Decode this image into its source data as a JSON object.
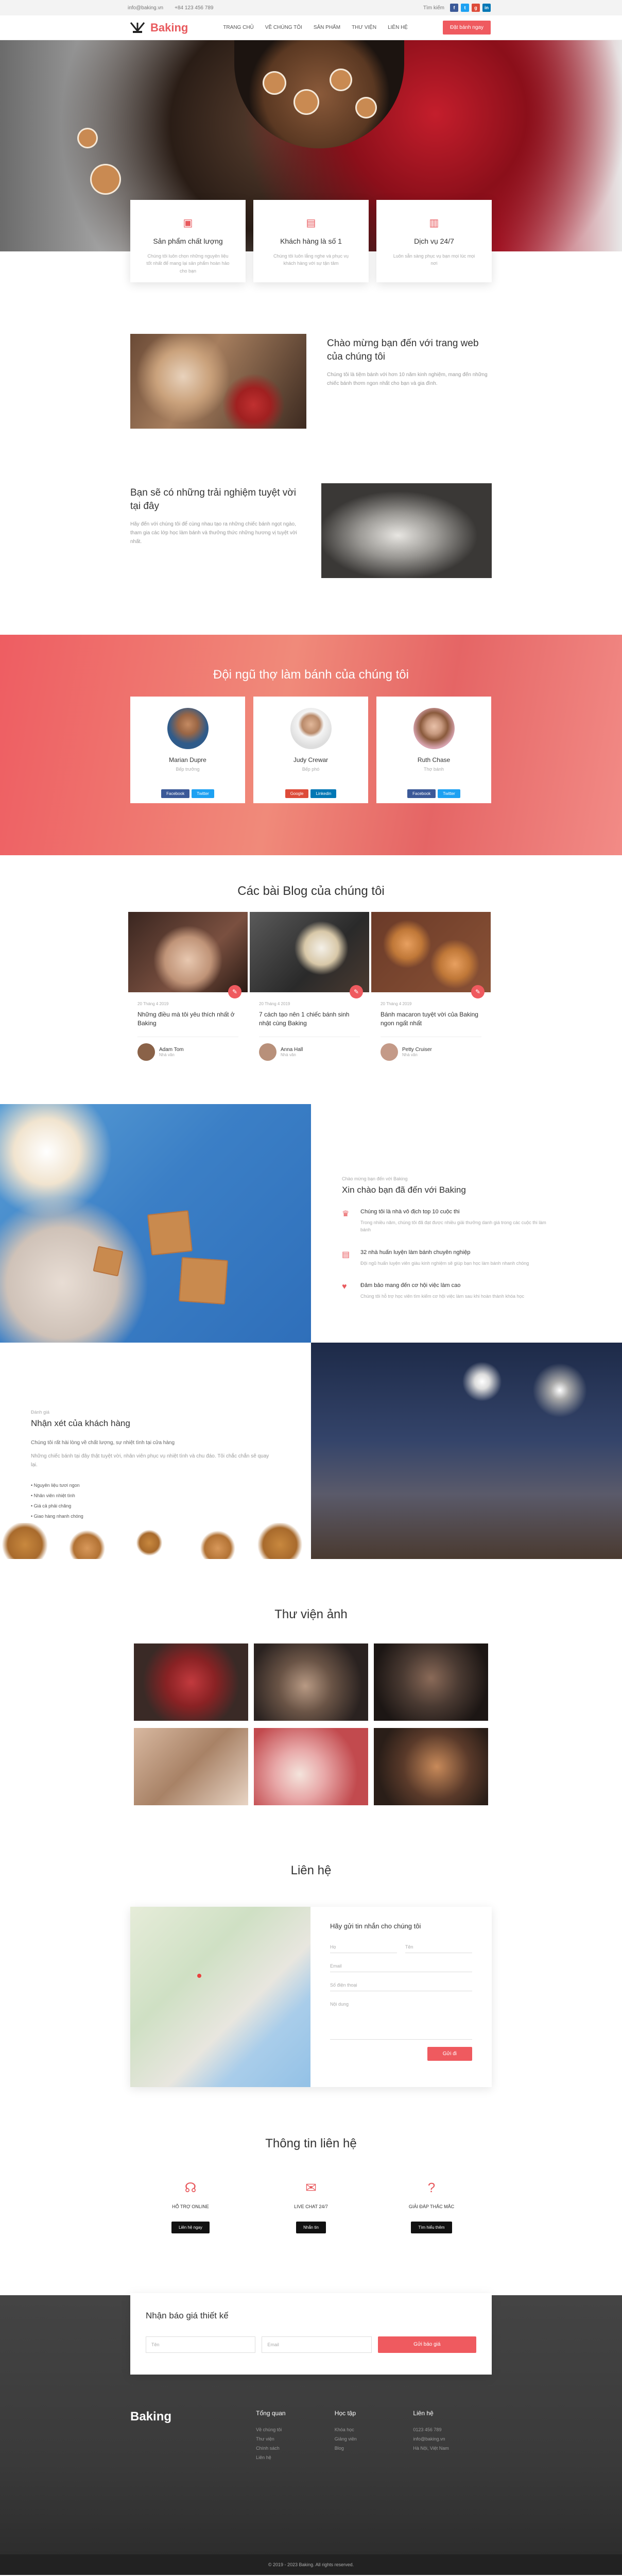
{
  "topbar": {
    "email": "info@baking.vn",
    "phone": "+84 123 456 789",
    "search": "Tìm kiếm",
    "social": [
      "f",
      "t",
      "g",
      "in"
    ]
  },
  "nav": {
    "logo": "Baking",
    "menu": [
      "Trang chủ",
      "Về chúng tôi",
      "Sản phẩm",
      "Thư viện",
      "Liên hệ"
    ],
    "cta": "Đặt bánh ngay"
  },
  "features": [
    {
      "icon": "gift-icon",
      "title": "Sản phẩm chất lượng",
      "text": "Chúng tôi luôn chọn những nguyên liệu tốt nhất để mang lại sản phẩm hoàn hảo cho bạn"
    },
    {
      "icon": "cart-icon",
      "title": "Khách hàng là số 1",
      "text": "Chúng tôi luôn lắng nghe và phục vụ khách hàng với sự tận tâm"
    },
    {
      "icon": "box-icon",
      "title": "Dịch vụ 24/7",
      "text": "Luôn sẵn sàng phục vụ bạn mọi lúc mọi nơi"
    }
  ],
  "about": {
    "title": "Chào mừng bạn đến với trang web của chúng tôi",
    "text": "Chúng tôi là tiệm bánh với hơn 10 năm kinh nghiệm, mang đến những chiếc bánh thơm ngon nhất cho bạn và gia đình."
  },
  "experience": {
    "title": "Bạn sẽ có những trải nghiệm tuyệt vời tại đây",
    "text": "Hãy đến với chúng tôi để cùng nhau tạo ra những chiếc bánh ngọt ngào, tham gia các lớp học làm bánh và thưởng thức những hương vị tuyệt vời nhất."
  },
  "team": {
    "title": "Đội ngũ thợ làm bánh của chúng tôi",
    "members": [
      {
        "name": "Marian Dupre",
        "role": "Bếp trưởng",
        "btn1": "Facebook",
        "btn2": "Twitter"
      },
      {
        "name": "Judy Crewar",
        "role": "Bếp phó",
        "btn1": "Google",
        "btn2": "Linkedin"
      },
      {
        "name": "Ruth Chase",
        "role": "Thợ bánh",
        "btn1": "Facebook",
        "btn2": "Twitter"
      }
    ]
  },
  "blog": {
    "title": "Các bài Blog của chúng tôi",
    "posts": [
      {
        "date": "20 Tháng 4 2019",
        "title": "Những điều mà tôi yêu thích nhất ở Baking",
        "author": "Adam Tom",
        "role": "Nhà văn"
      },
      {
        "date": "20 Tháng 4 2019",
        "title": "7 cách tạo nên 1 chiếc bánh sinh nhật cùng Baking",
        "author": "Anna Hall",
        "role": "Nhà văn"
      },
      {
        "date": "20 Tháng 4 2019",
        "title": "Bánh macaron tuyệt vời của Baking ngon ngất nhất",
        "author": "Petty Cruiser",
        "role": "Nhà văn"
      }
    ]
  },
  "welcome": {
    "kicker": "Chào mừng bạn đến với Baking",
    "title": "Xin chào bạn đã đến với Baking",
    "items": [
      {
        "icon": "trophy-icon",
        "title": "Chúng tôi là nhà vô địch top 10 cuộc thi",
        "text": "Trong nhiều năm, chúng tôi đã đạt được nhiều giải thưởng danh giá trong các cuộc thi làm bánh"
      },
      {
        "icon": "book-icon",
        "title": "32 nhà huấn luyện làm bánh chuyên nghiệp",
        "text": "Đội ngũ huấn luyện viên giàu kinh nghiệm sẽ giúp bạn học làm bánh nhanh chóng"
      },
      {
        "icon": "heart-icon",
        "title": "Đảm bảo mang đến cơ hội việc làm cao",
        "text": "Chúng tôi hỗ trợ học viên tìm kiếm cơ hội việc làm sau khi hoàn thành khóa học"
      }
    ]
  },
  "review": {
    "kicker": "Đánh giá",
    "title": "Nhận xét của khách hàng",
    "lead": "Chúng tôi rất hài lòng về chất lượng, sự nhiệt tình tại cửa hàng",
    "text": "Những chiếc bánh tại đây thật tuyệt vời, nhân viên phục vụ nhiệt tình và chu đáo. Tôi chắc chắn sẽ quay lại.",
    "bullets": [
      "Nguyên liệu tươi ngon",
      "Nhân viên nhiệt tình",
      "Giá cả phải chăng",
      "Giao hàng nhanh chóng"
    ]
  },
  "gallery": {
    "title": "Thư viện ảnh"
  },
  "contact": {
    "title": "Liên hệ",
    "form_title": "Hãy gửi tin nhắn cho chúng tôi",
    "fields": [
      "Họ",
      "Tên",
      "Email",
      "Số điện thoại",
      "Nội dung"
    ],
    "submit": "Gửi đi"
  },
  "info": {
    "title": "Thông tin liên hệ",
    "cols": [
      {
        "icon": "headset-icon",
        "title": "HỖ TRỢ ONLINE",
        "btn": "Liên hệ ngay"
      },
      {
        "icon": "chat-icon",
        "title": "LIVE CHAT 24/7",
        "btn": "Nhắn tin"
      },
      {
        "icon": "question-icon",
        "title": "GIẢI ĐÁP THẮC MẮC",
        "btn": "Tìm hiểu thêm"
      }
    ]
  },
  "quote": {
    "title": "Nhận báo giá thiết kế",
    "name": "Tên",
    "email": "Email",
    "btn": "Gửi báo giá"
  },
  "footer": {
    "logo": "Baking",
    "cols": [
      {
        "title": "Tổng quan",
        "links": [
          "Về chúng tôi",
          "Thư viện",
          "Chính sách",
          "Liên hệ"
        ]
      },
      {
        "title": "Học tập",
        "links": [
          "Khóa học",
          "Giảng viên",
          "Blog"
        ]
      },
      {
        "title": "Liên hệ",
        "links": [
          "0123 456 789",
          "info@baking.vn",
          "Hà Nội, Việt Nam"
        ]
      }
    ],
    "copyright": "© 2019 - 2023 Baking. All rights reserved."
  }
}
